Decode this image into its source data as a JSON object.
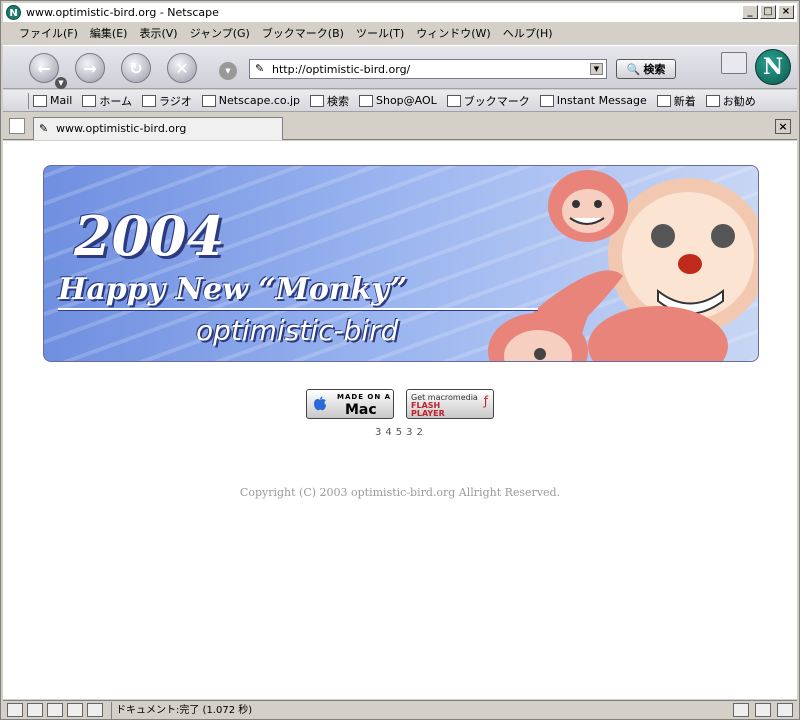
{
  "window": {
    "title": "www.optimistic-bird.org - Netscape",
    "app_icon": "N"
  },
  "menu": [
    "ファイル(F)",
    "編集(E)",
    "表示(V)",
    "ジャンプ(G)",
    "ブックマーク(B)",
    "ツール(T)",
    "ウィンドウ(W)",
    "ヘルプ(H)"
  ],
  "nav": {
    "url": "http://optimistic-bird.org/",
    "search_label": "検索",
    "logo": "N"
  },
  "personal_toolbar": [
    "Mail",
    "ホーム",
    "ラジオ",
    "Netscape.co.jp",
    "検索",
    "Shop@AOL",
    "ブックマーク",
    "Instant Message",
    "新着",
    "お勧め"
  ],
  "tab": {
    "label": "www.optimistic-bird.org"
  },
  "banner": {
    "year": "2004",
    "headline": "Happy New “Monky”",
    "site": "optimistic-bird"
  },
  "badges": {
    "mac_small": "MADE ON A",
    "mac_big": "Mac",
    "flash_small": "Get macromedia",
    "flash_big1": "FLASH",
    "flash_big2": "PLAYER"
  },
  "counter": "34532",
  "copyright": "Copyright (C) 2003 optimistic-bird.org Allright Reserved.",
  "status": {
    "text": "ドキュメント:完了 (1.072 秒)"
  },
  "colors": {
    "banner_blue": "#6f8fe0",
    "netscape_green": "#1e7a6e",
    "flash_red": "#c0202a"
  }
}
